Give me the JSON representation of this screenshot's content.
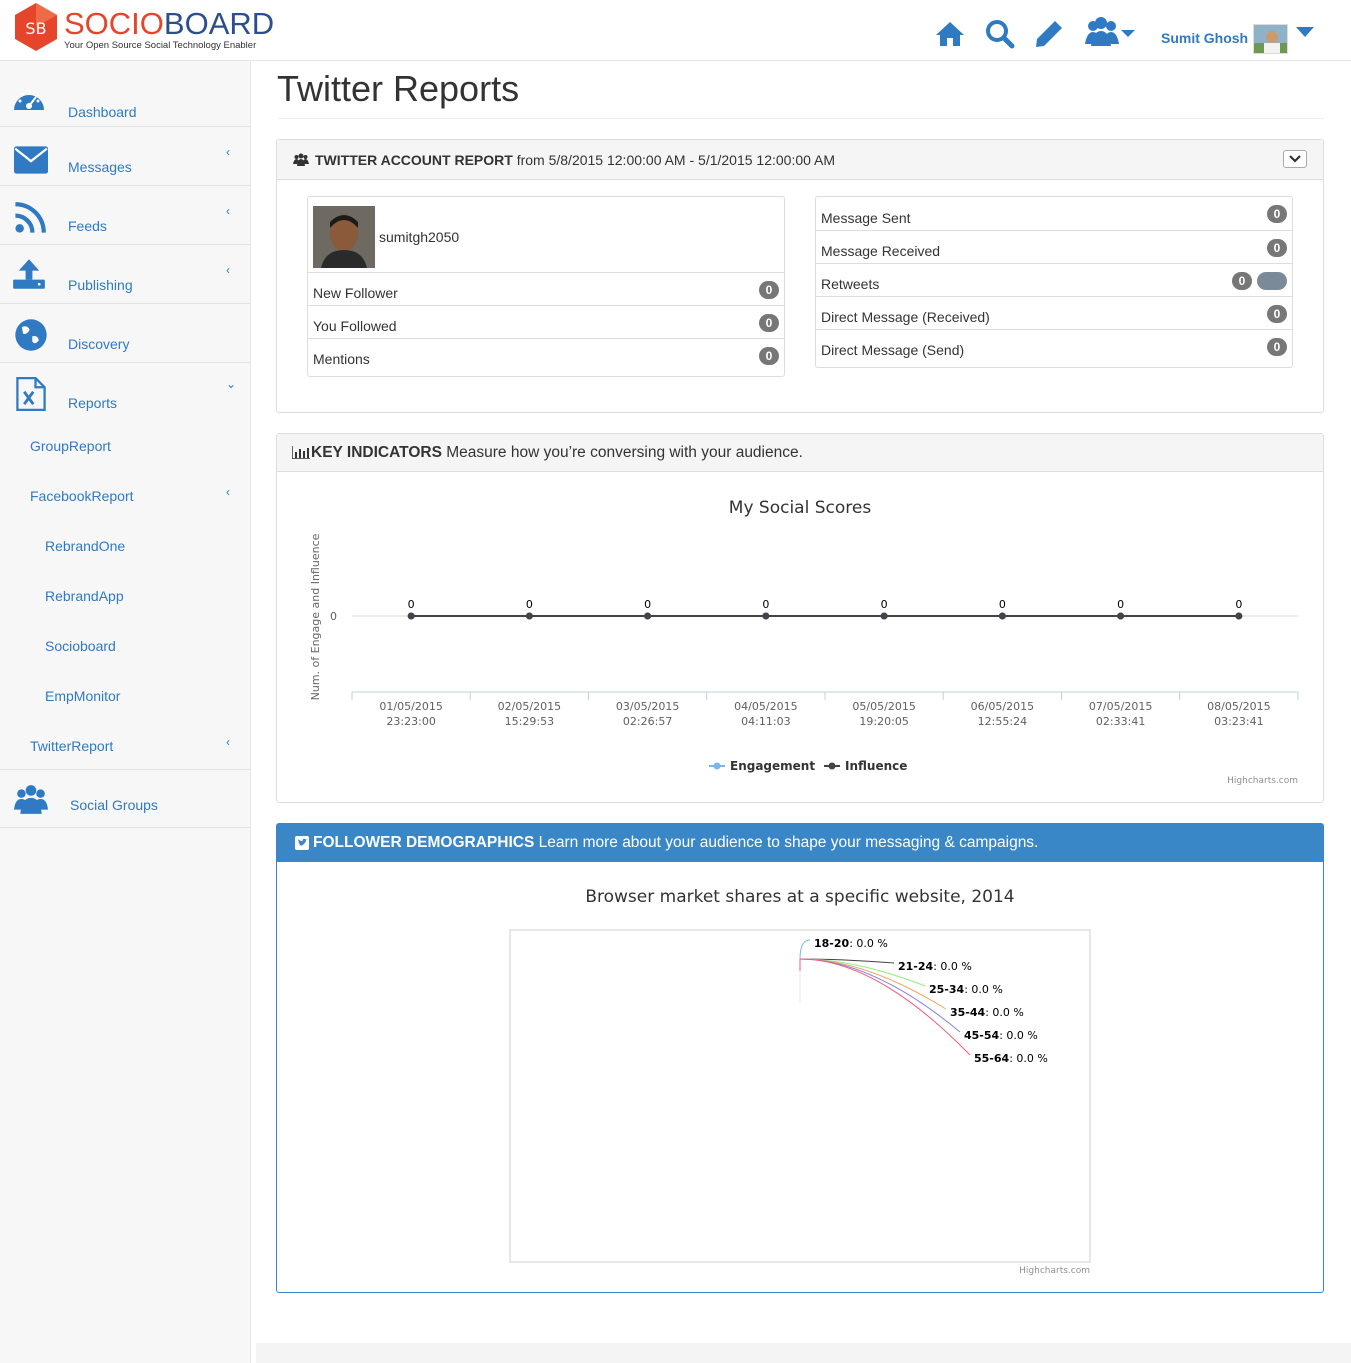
{
  "brand": {
    "logo_badge": "SB",
    "name_part1": "SOCIO",
    "name_part2": "BOARD",
    "tagline": "Your Open Source Social Technology Enabler",
    "red": "#e5452b",
    "blue": "#2b4f8c"
  },
  "topnav": {
    "icons": [
      "home-icon",
      "search-icon",
      "pencil-icon",
      "users-icon"
    ],
    "user_name": "Sumit Ghosh",
    "accent": "#2f7ac3"
  },
  "sidebar": {
    "items": [
      {
        "label": "Dashboard",
        "icon": "dashboard-icon"
      },
      {
        "label": "Messages",
        "icon": "envelope-icon"
      },
      {
        "label": "Feeds",
        "icon": "rss-icon"
      },
      {
        "label": "Publishing",
        "icon": "upload-icon"
      },
      {
        "label": "Discovery",
        "icon": "globe-icon"
      },
      {
        "label": "Reports",
        "icon": "excel-file-icon"
      }
    ],
    "sub_items": [
      {
        "label": "GroupReport"
      },
      {
        "label": "FacebookReport"
      },
      {
        "label": "RebrandOne"
      },
      {
        "label": "RebrandApp"
      },
      {
        "label": "Socioboard"
      },
      {
        "label": "EmpMonitor"
      },
      {
        "label": "TwitterReport"
      }
    ],
    "social_groups": {
      "label": "Social Groups",
      "icon": "users-icon"
    }
  },
  "page": {
    "title": "Twitter Reports"
  },
  "account_report": {
    "heading_bold": "TWITTER ACCOUNT REPORT",
    "heading_rest": " from 5/8/2015 12:00:00 AM - 5/1/2015 12:00:00 AM",
    "username": "sumitgh2050",
    "left_rows": [
      {
        "label": "New Follower",
        "value": "0"
      },
      {
        "label": "You Followed",
        "value": "0"
      },
      {
        "label": "Mentions",
        "value": "0"
      }
    ],
    "right_rows": [
      {
        "label": "Message Sent",
        "value": "0"
      },
      {
        "label": "Message Received",
        "value": "0"
      },
      {
        "label": "Retweets",
        "value": "0"
      },
      {
        "label": "Direct Message (Received)",
        "value": "0"
      },
      {
        "label": "Direct Message (Send)",
        "value": "0"
      }
    ]
  },
  "key_indicators": {
    "heading_bold": "KEY INDICATORS",
    "heading_rest": " Measure how you’re conversing with your audience."
  },
  "follower_demographics": {
    "heading_bold": "FOLLOWER DEMOGRAPHICS",
    "heading_rest": " Learn more about your audience to shape your messaging & campaigns."
  },
  "chart_data": [
    {
      "type": "line",
      "title": "My Social Scores",
      "ylabel": "Num. of Engage and Influence",
      "xlabel": "",
      "x": [
        "01/05/2015 23:23:00",
        "02/05/2015 15:29:53",
        "03/05/2015 02:26:57",
        "04/05/2015 04:11:03",
        "05/05/2015 19:20:05",
        "06/05/2015 12:55:24",
        "07/05/2015 02:33:41",
        "08/05/2015 03:23:41"
      ],
      "y_ticks": [
        "0"
      ],
      "series": [
        {
          "name": "Engagement",
          "values": [
            0,
            0,
            0,
            0,
            0,
            0,
            0,
            0
          ],
          "color": "#7cb5ec"
        },
        {
          "name": "Influence",
          "values": [
            0,
            0,
            0,
            0,
            0,
            0,
            0,
            0
          ],
          "color": "#434348"
        }
      ],
      "credit": "Highcharts.com",
      "legend": "bottom-center",
      "grid": true
    },
    {
      "type": "pie",
      "title": "Browser market shares at a specific website, 2014",
      "categories": [
        "18-20",
        "21-24",
        "25-34",
        "35-44",
        "45-54",
        "55-64"
      ],
      "values": [
        0.0,
        0.0,
        0.0,
        0.0,
        0.0,
        0.0
      ],
      "unit": "%",
      "colors": [
        "#7cb5ec",
        "#434348",
        "#90ed7d",
        "#f7a35c",
        "#8085e9",
        "#f15c80"
      ],
      "credit": "Highcharts.com"
    }
  ]
}
